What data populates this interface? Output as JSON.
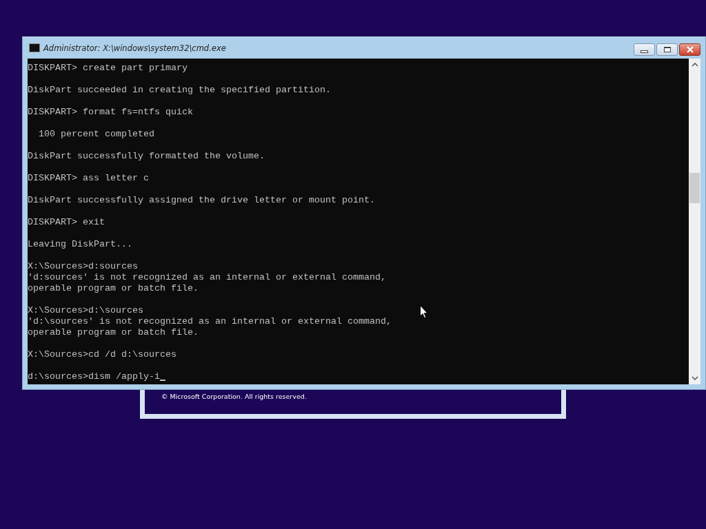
{
  "background_dialog": {
    "copyright": "© Microsoft Corporation. All rights reserved."
  },
  "window": {
    "title": "Administrator: X:\\windows\\system32\\cmd.exe"
  },
  "console": {
    "blocks": [
      [
        "DISKPART> create part primary"
      ],
      [
        "DiskPart succeeded in creating the specified partition."
      ],
      [
        "DISKPART> format fs=ntfs quick"
      ],
      [
        "  100 percent completed"
      ],
      [
        "DiskPart successfully formatted the volume."
      ],
      [
        "DISKPART> ass letter c"
      ],
      [
        "DiskPart successfully assigned the drive letter or mount point."
      ],
      [
        "DISKPART> exit"
      ],
      [
        "Leaving DiskPart..."
      ],
      [
        "X:\\Sources>d:sources",
        "'d:sources' is not recognized as an internal or external command,",
        "operable program or batch file."
      ],
      [
        "X:\\Sources>d:\\sources",
        "'d:\\sources' is not recognized as an internal or external command,",
        "operable program or batch file."
      ],
      [
        "X:\\Sources>cd /d d:\\sources"
      ],
      [
        "d:\\sources>dism /apply-i"
      ]
    ],
    "cursor": true
  }
}
